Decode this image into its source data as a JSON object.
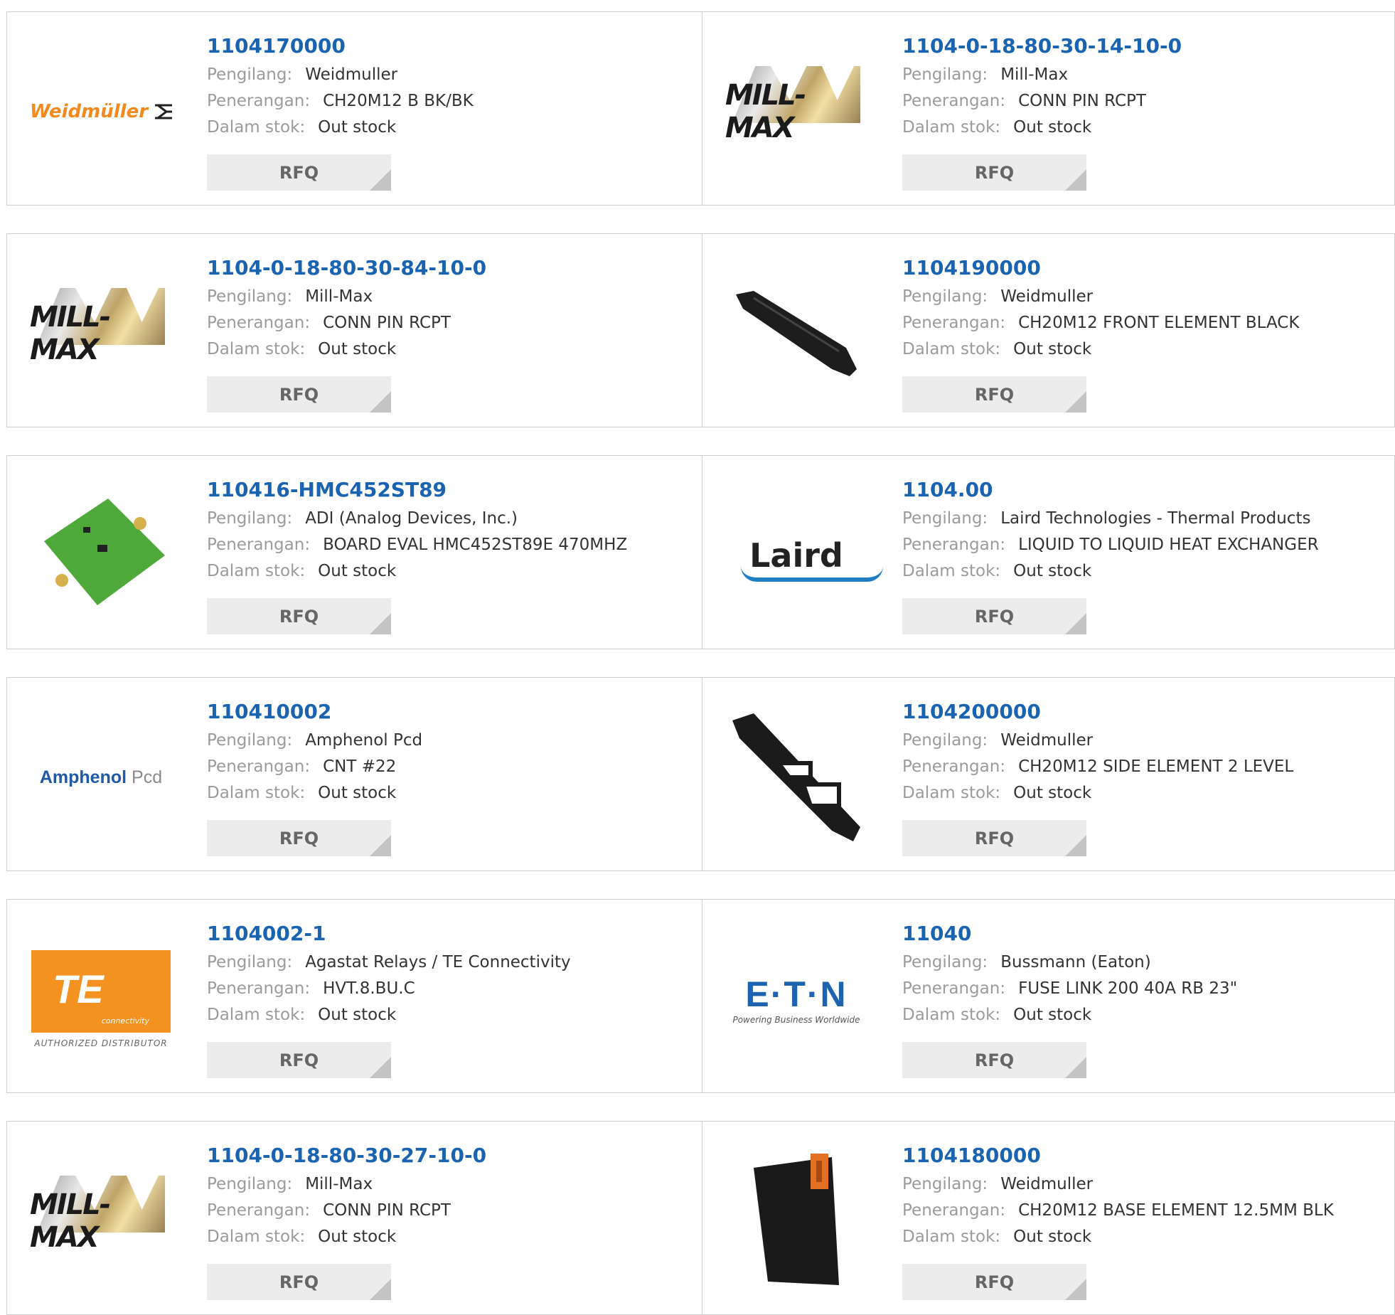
{
  "labels": {
    "manufacturer": "Pengilang:",
    "description": "Penerangan:",
    "stock": "Dalam stok:",
    "rfq": "RFQ"
  },
  "products": [
    {
      "part": "1104170000",
      "manufacturer": "Weidmuller",
      "description": "CH20M12 B BK/BK",
      "stock": "Out stock",
      "logo": "Weidmüller"
    },
    {
      "part": "1104-0-18-80-30-14-10-0",
      "manufacturer": "Mill-Max",
      "description": "CONN PIN RCPT",
      "stock": "Out stock",
      "logo": "MILL-MAX"
    },
    {
      "part": "1104-0-18-80-30-84-10-0",
      "manufacturer": "Mill-Max",
      "description": "CONN PIN RCPT",
      "stock": "Out stock",
      "logo": "MILL-MAX"
    },
    {
      "part": "1104190000",
      "manufacturer": "Weidmuller",
      "description": "CH20M12 FRONT ELEMENT BLACK",
      "stock": "Out stock",
      "logo": ""
    },
    {
      "part": "110416-HMC452ST89",
      "manufacturer": "ADI (Analog Devices, Inc.)",
      "description": "BOARD EVAL HMC452ST89E 470MHZ",
      "stock": "Out stock",
      "logo": ""
    },
    {
      "part": "1104.00",
      "manufacturer": "Laird Technologies - Thermal Products",
      "description": "LIQUID TO LIQUID HEAT EXCHANGER",
      "stock": "Out stock",
      "logo": "Laird"
    },
    {
      "part": "110410002",
      "manufacturer": "Amphenol Pcd",
      "description": "CNT #22",
      "stock": "Out stock",
      "logo": "Amphenol",
      "logo2": "Pcd"
    },
    {
      "part": "1104200000",
      "manufacturer": "Weidmuller",
      "description": "CH20M12 SIDE ELEMENT 2 LEVEL",
      "stock": "Out stock",
      "logo": ""
    },
    {
      "part": "1104002-1",
      "manufacturer": "Agastat Relays / TE Connectivity",
      "description": "HVT.8.BU.C",
      "stock": "Out stock",
      "logo": "TE",
      "logo2": "connectivity",
      "logo3": "AUTHORIZED DISTRIBUTOR"
    },
    {
      "part": "11040",
      "manufacturer": "Bussmann (Eaton)",
      "description": "FUSE LINK 200 40A RB 23\"",
      "stock": "Out stock",
      "logo": "E·T·N",
      "logo2": "Powering Business Worldwide"
    },
    {
      "part": "1104-0-18-80-30-27-10-0",
      "manufacturer": "Mill-Max",
      "description": "CONN PIN RCPT",
      "stock": "Out stock",
      "logo": "MILL-MAX"
    },
    {
      "part": "1104180000",
      "manufacturer": "Weidmuller",
      "description": "CH20M12 BASE ELEMENT 12.5MM BLK",
      "stock": "Out stock",
      "logo": ""
    }
  ]
}
